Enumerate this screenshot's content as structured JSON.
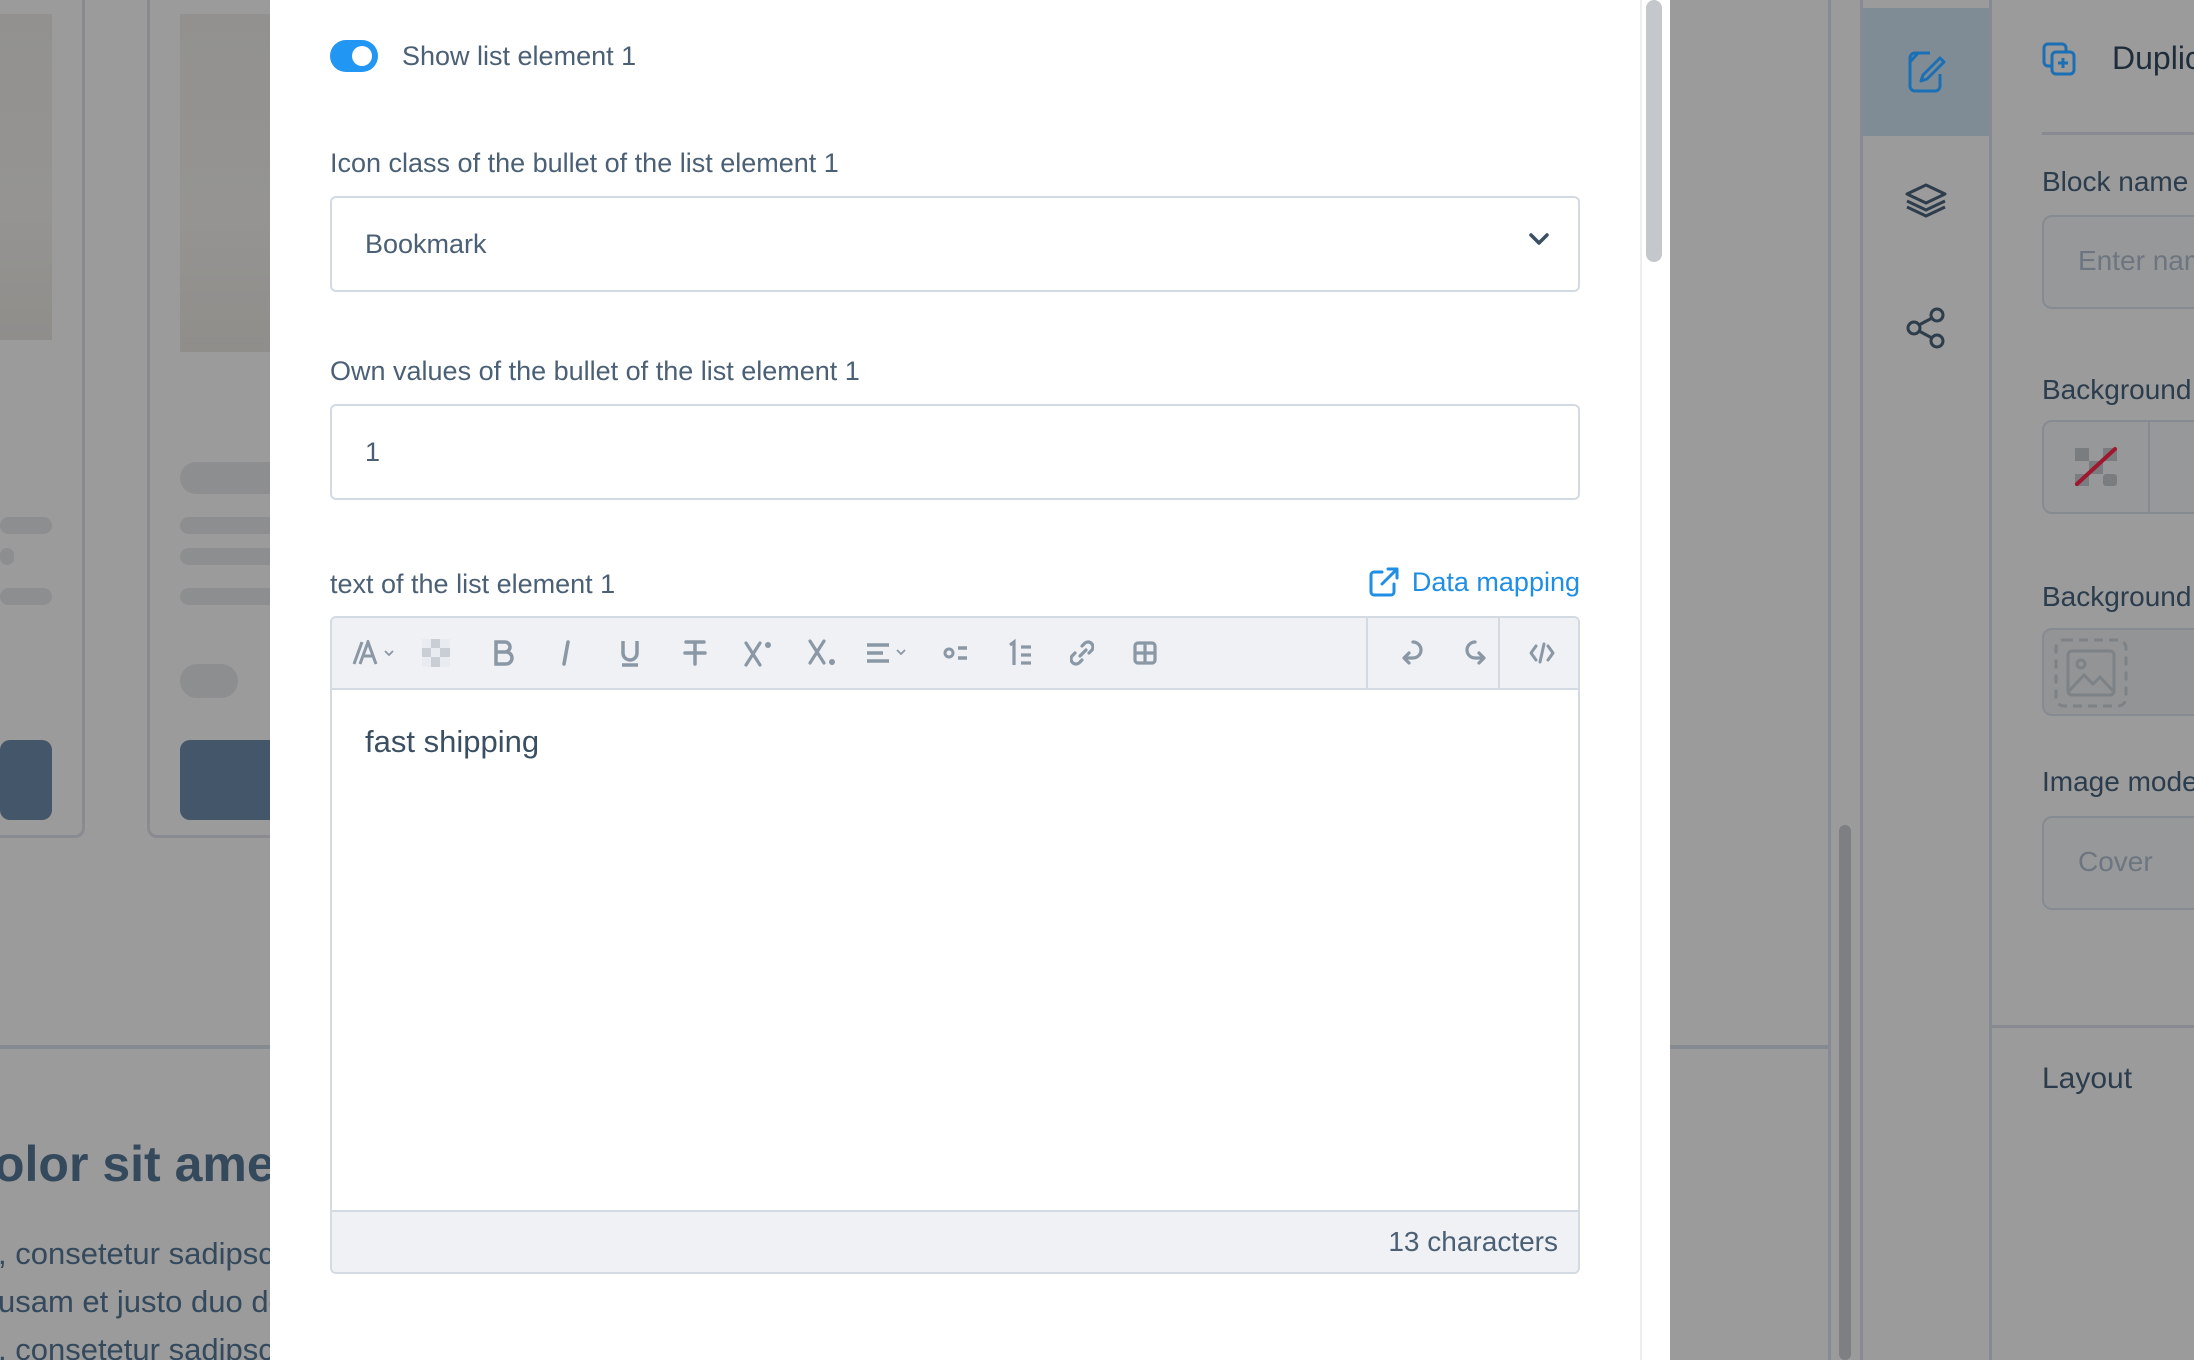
{
  "background": {
    "heading_fragment": "olor sit ame",
    "text_lines": [
      ", consetetur sadipsci",
      "usam et justo duo do",
      ", consetetur sadipsci"
    ]
  },
  "sidebar": {
    "rail_items": [
      {
        "icon": "edit-document-icon",
        "active": true
      },
      {
        "icon": "layers-icon",
        "active": false
      },
      {
        "icon": "share-icon",
        "active": false
      }
    ],
    "header_label": "Duplic",
    "block_name_label": "Block name",
    "block_name_placeholder": "Enter nam",
    "background_color_label": "Background c",
    "background_image_label": "Background i",
    "image_mode_label": "Image mode",
    "image_mode_value": "Cover",
    "layout_section": "Layout"
  },
  "modal": {
    "toggle": {
      "label": "Show list element 1",
      "on": true
    },
    "icon_class": {
      "label": "Icon class of the bullet of the list element 1",
      "value": "Bookmark"
    },
    "own_values": {
      "label": "Own values of the bullet of the list element 1",
      "value": "1"
    },
    "text_field": {
      "label": "text of the list element 1",
      "data_mapping_label": "Data mapping",
      "content": "fast shipping",
      "char_count": "13 characters",
      "toolbar": [
        "font-size",
        "highlight",
        "bold",
        "italic",
        "underline",
        "strikethrough",
        "superscript",
        "subscript",
        "align",
        "bullet-list",
        "numbered-list",
        "link",
        "table",
        "undo",
        "redo",
        "source-code"
      ]
    }
  },
  "colors": {
    "accent": "#2196f3",
    "link": "#1e8fe4",
    "no_color_slash": "#a0182f"
  }
}
